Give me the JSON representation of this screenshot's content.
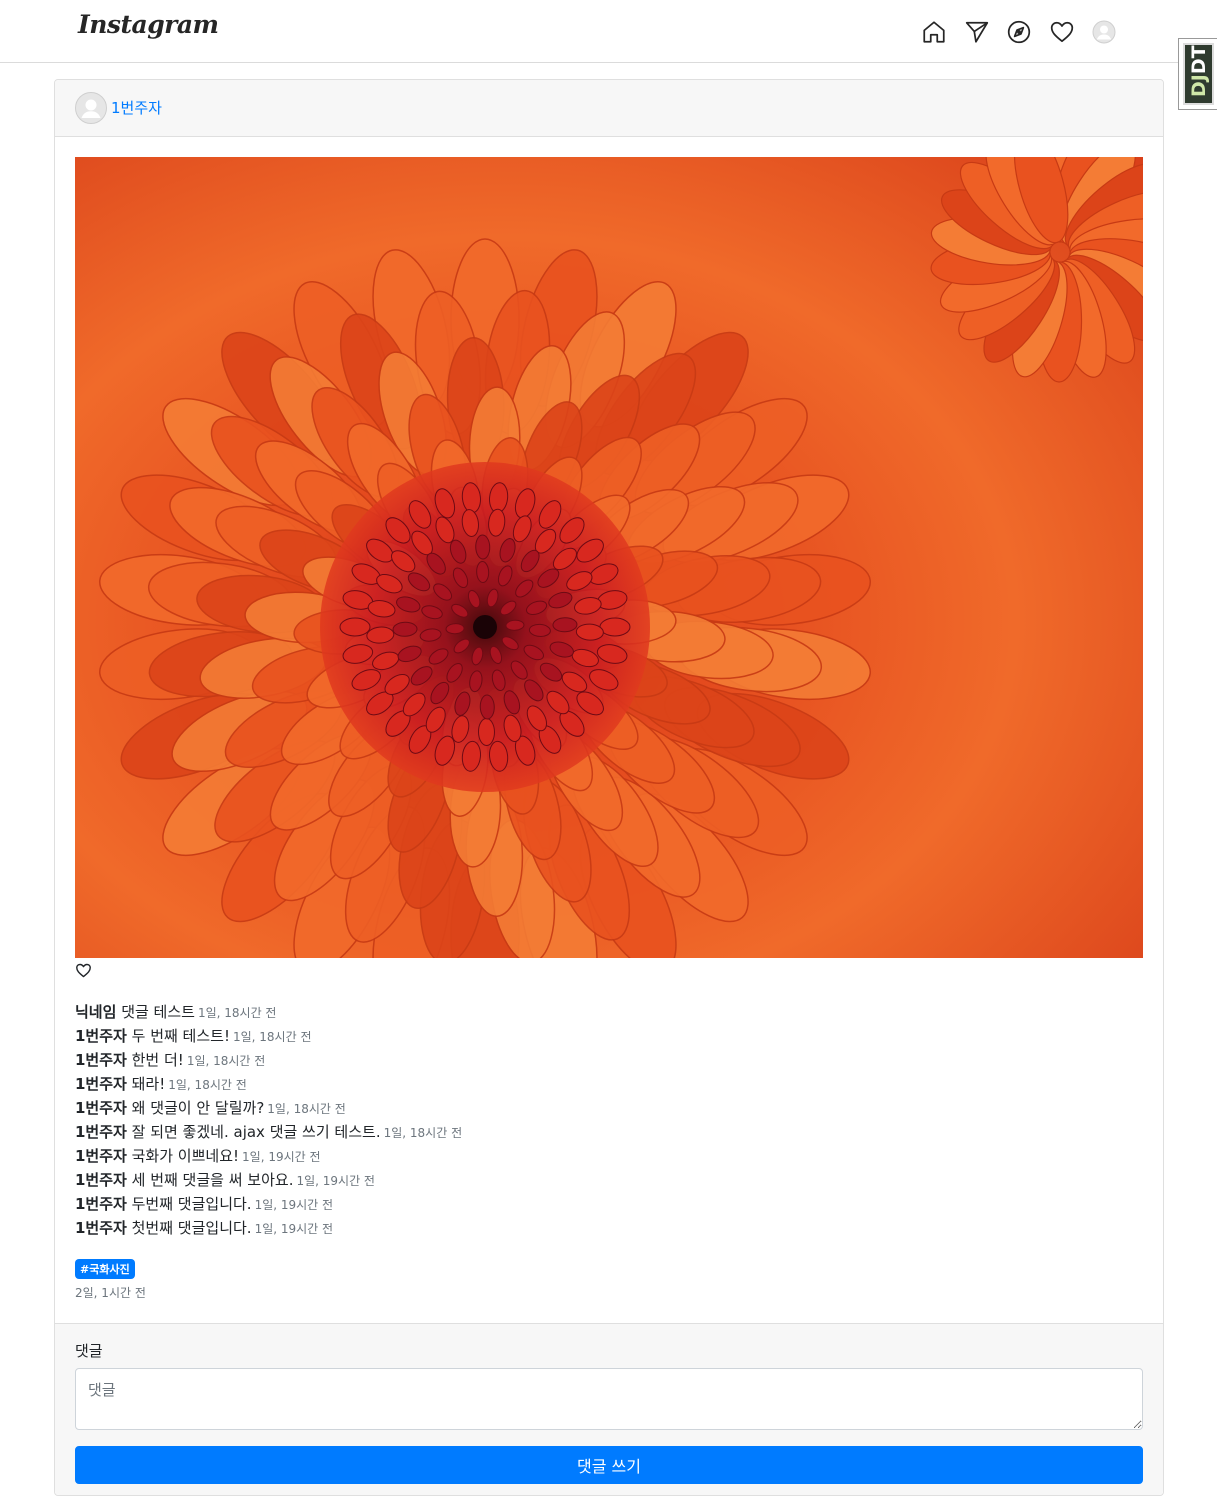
{
  "nav": {
    "logo": "Instagram",
    "icons": [
      "home-icon",
      "send-icon",
      "explore-icon",
      "heart-icon",
      "profile-avatar-icon"
    ]
  },
  "debug_toolbar": {
    "label_prefix": "DJ",
    "label_suffix": "DT"
  },
  "post": {
    "author": "1번주자",
    "image": {
      "subject": "orange chrysanthemum flower",
      "colors": [
        "#e4461b",
        "#f06a2a",
        "#b8141e"
      ]
    },
    "comments": [
      {
        "author": "닉네임",
        "text": "댓글 테스트",
        "time": "1일, 18시간 전"
      },
      {
        "author": "1번주자",
        "text": "두 번째 테스트!",
        "time": "1일, 18시간 전"
      },
      {
        "author": "1번주자",
        "text": "한번 더!",
        "time": "1일, 18시간 전"
      },
      {
        "author": "1번주자",
        "text": "돼라!",
        "time": "1일, 18시간 전"
      },
      {
        "author": "1번주자",
        "text": "왜 댓글이 안 달릴까?",
        "time": "1일, 18시간 전"
      },
      {
        "author": "1번주자",
        "text": "잘 되면 좋겠네. ajax 댓글 쓰기 테스트.",
        "time": "1일, 18시간 전"
      },
      {
        "author": "1번주자",
        "text": "국화가 이쁘네요!",
        "time": "1일, 19시간 전"
      },
      {
        "author": "1번주자",
        "text": "세 번째 댓글을 써 보아요.",
        "time": "1일, 19시간 전"
      },
      {
        "author": "1번주자",
        "text": "두번째 댓글입니다.",
        "time": "1일, 19시간 전"
      },
      {
        "author": "1번주자",
        "text": "첫번째 댓글입니다.",
        "time": "1일, 19시간 전"
      }
    ],
    "tag": "#국화사진",
    "posted_time": "2일, 1시간 전"
  },
  "comment_form": {
    "label": "댓글",
    "placeholder": "댓글",
    "submit_label": "댓글 쓰기"
  },
  "colors": {
    "primary": "#007bff",
    "muted": "#6c757d",
    "card_bg": "#f7f7f7"
  }
}
